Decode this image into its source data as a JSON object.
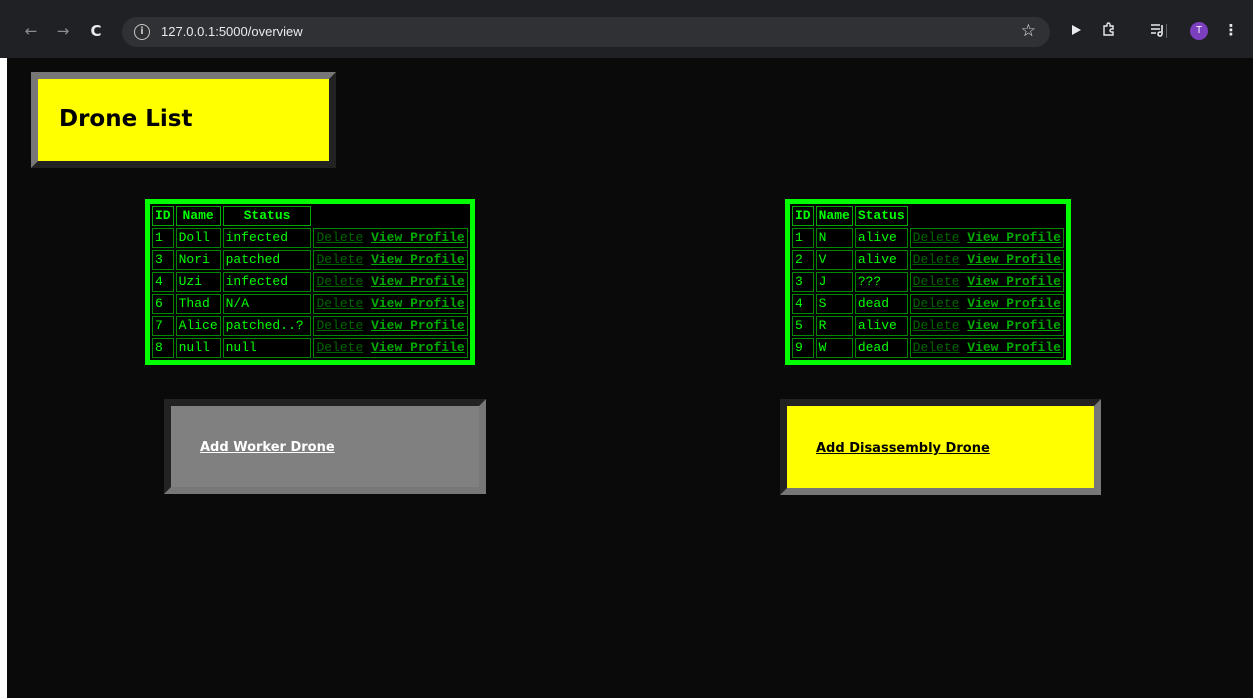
{
  "browser": {
    "url": "127.0.0.1:5000/overview",
    "back_icon": "←",
    "forward_icon": "→",
    "reload_icon": "C",
    "info_icon": "i",
    "star_icon": "☆",
    "avatar_initial": "T",
    "menu_icon": "⋮"
  },
  "page": {
    "title": "Drone List",
    "colors": {
      "title_bg": "#ffff00",
      "table_text": "#00ff00",
      "table_border": "#00ff00",
      "worker_button_bg": "#808080",
      "disassembly_button_bg": "#ffff00",
      "page_bg": "#0a0a0a"
    }
  },
  "worker_table": {
    "headers": [
      "ID",
      "Name",
      "Status"
    ],
    "rows": [
      {
        "id": "1",
        "name": "Doll",
        "status": "infected",
        "delete": "Delete",
        "view": "View Profile"
      },
      {
        "id": "3",
        "name": "Nori",
        "status": "patched",
        "delete": "Delete",
        "view": "View Profile"
      },
      {
        "id": "4",
        "name": "Uzi",
        "status": "infected",
        "delete": "Delete",
        "view": "View Profile"
      },
      {
        "id": "6",
        "name": "Thad",
        "status": "N/A",
        "delete": "Delete",
        "view": "View Profile"
      },
      {
        "id": "7",
        "name": "Alice",
        "status": "patched..?",
        "delete": "Delete",
        "view": "View Profile"
      },
      {
        "id": "8",
        "name": "null",
        "status": "null",
        "delete": "Delete",
        "view": "View Profile"
      }
    ]
  },
  "disassembly_table": {
    "headers": [
      "ID",
      "Name",
      "Status"
    ],
    "rows": [
      {
        "id": "1",
        "name": "N",
        "status": "alive",
        "delete": "Delete",
        "view": "View Profile"
      },
      {
        "id": "2",
        "name": "V",
        "status": "alive",
        "delete": "Delete",
        "view": "View Profile"
      },
      {
        "id": "3",
        "name": "J",
        "status": "???",
        "delete": "Delete",
        "view": "View Profile"
      },
      {
        "id": "4",
        "name": "S",
        "status": "dead",
        "delete": "Delete",
        "view": "View Profile"
      },
      {
        "id": "5",
        "name": "R",
        "status": "alive",
        "delete": "Delete",
        "view": "View Profile"
      },
      {
        "id": "9",
        "name": "W",
        "status": "dead",
        "delete": "Delete",
        "view": "View Profile"
      }
    ]
  },
  "actions": {
    "add_worker": "Add Worker Drone",
    "add_disassembly": "Add Disassembly Drone"
  }
}
